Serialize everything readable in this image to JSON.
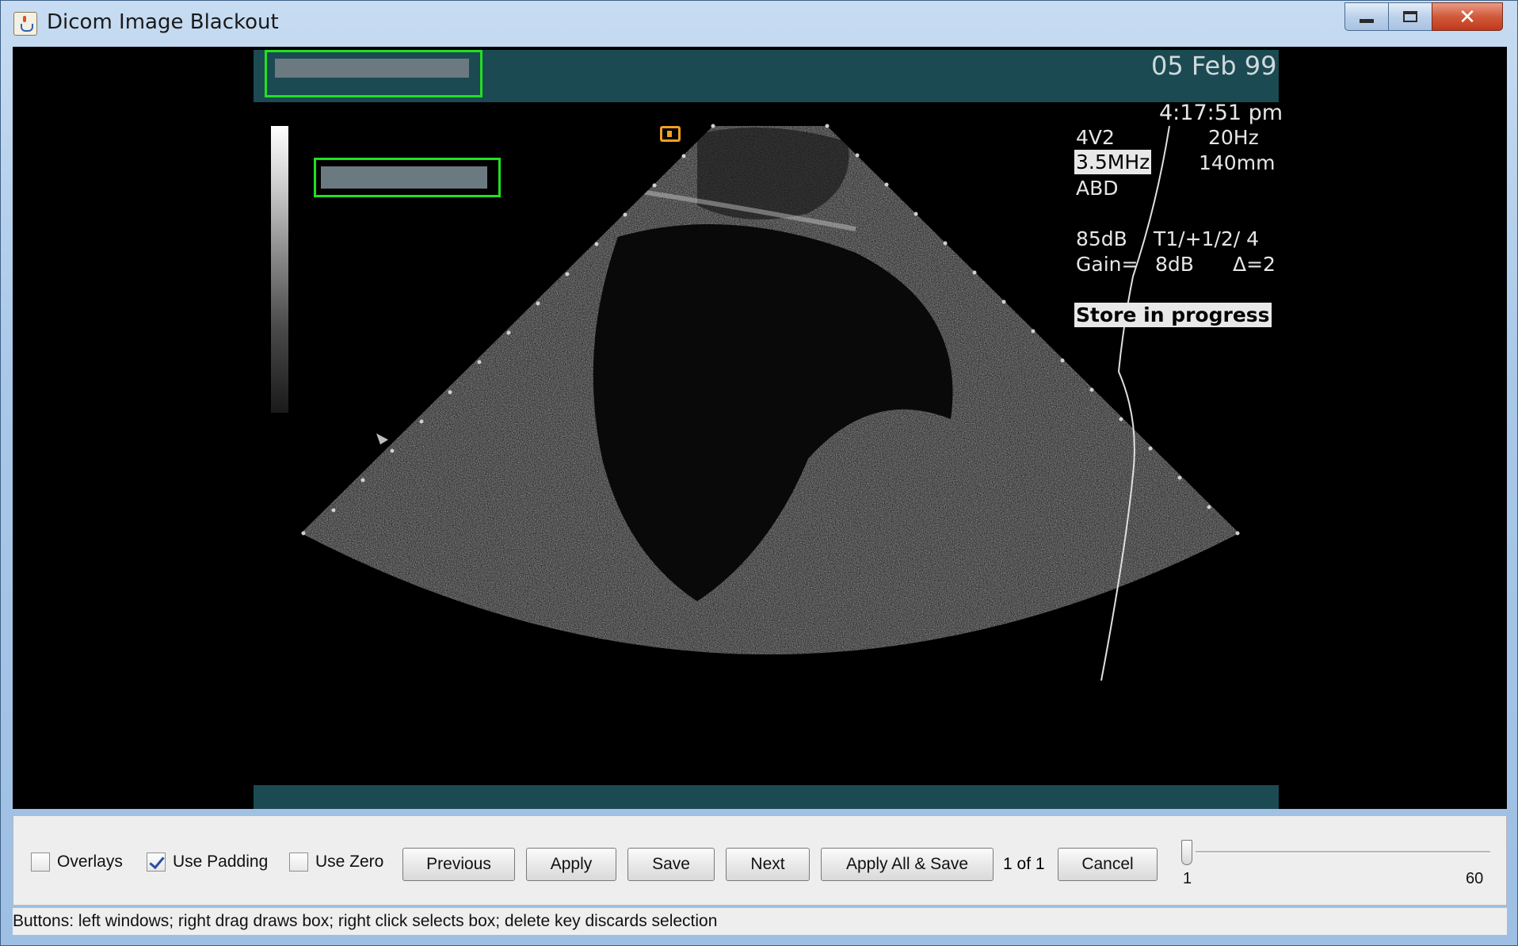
{
  "window": {
    "title": "Dicom Image Blackout",
    "minimize_icon": "minimize-icon",
    "maximize_icon": "maximize-icon",
    "close_glyph": "✕"
  },
  "image": {
    "date": "05 Feb 99",
    "time": "4:17:51 pm",
    "probe": "4V2",
    "frame_rate": "20Hz",
    "frequency": "3.5MHz",
    "depth": "140mm",
    "preset": "ABD",
    "power": "85dB",
    "mode_settings": "T1/+1/2/ 4",
    "gain_label": "Gain=",
    "gain_value": "8dB",
    "delta": "Δ=2",
    "store_status": "Store in progress"
  },
  "controls": {
    "overlays": {
      "label": "Overlays",
      "checked": false
    },
    "use_padding": {
      "label": "Use Padding",
      "checked": true
    },
    "use_zero": {
      "label": "Use Zero",
      "checked": false
    },
    "previous_label": "Previous",
    "apply_label": "Apply",
    "save_label": "Save",
    "next_label": "Next",
    "apply_all_label": "Apply All & Save",
    "page_count": "1 of 1",
    "cancel_label": "Cancel",
    "slider": {
      "min_label": "1",
      "max_label": "60",
      "value": 1
    }
  },
  "status": {
    "text": "Buttons: left windows; right drag draws box; right click selects box; delete key discards selection"
  },
  "colors": {
    "overlay_band": "#1b4a52",
    "selection_box": "#22e022",
    "close_button": "#c0391c"
  }
}
